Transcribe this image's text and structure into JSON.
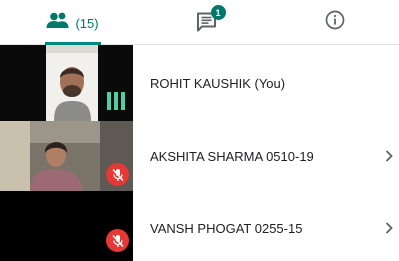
{
  "tabs": {
    "people": {
      "icon": "people-icon",
      "count": "(15)",
      "active": true
    },
    "chat": {
      "icon": "chat-icon",
      "badge": "1"
    },
    "info": {
      "icon": "info-icon"
    }
  },
  "colors": {
    "accent": "#00796b",
    "indicator": "#00897b",
    "mic_off": "#e53935",
    "speaking_bars": "#4dd0a5"
  },
  "participants": [
    {
      "name": "ROHIT KAUSHIK (You)",
      "status_icon": "audio-level-icon",
      "has_chevron": false
    },
    {
      "name": "AKSHITA SHARMA 0510-19",
      "status_icon": "mic-off-icon",
      "has_chevron": true
    },
    {
      "name": "VANSH PHOGAT 0255-15",
      "status_icon": "mic-off-icon",
      "has_chevron": true
    }
  ]
}
